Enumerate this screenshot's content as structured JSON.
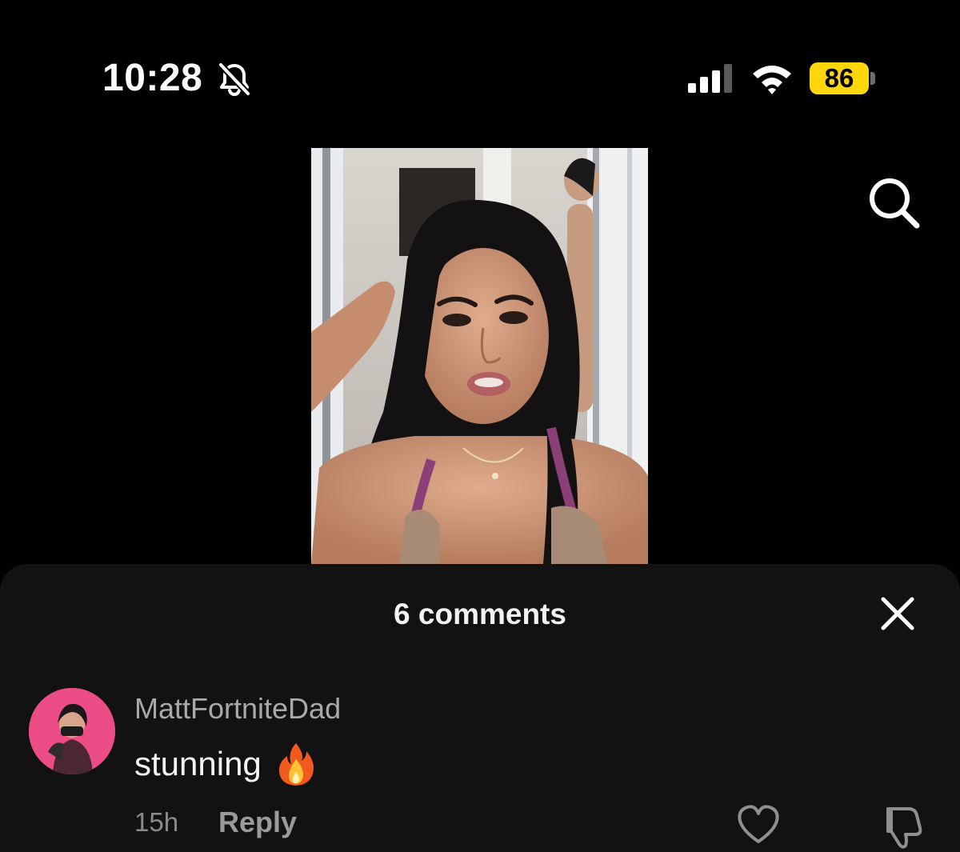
{
  "status_bar": {
    "time": "10:28",
    "battery_level": "86",
    "icons": [
      "bell-slash-icon",
      "cellular-signal-icon",
      "wifi-icon",
      "battery-icon"
    ]
  },
  "video": {
    "description_icon": "video-frame"
  },
  "top_actions": {
    "search_icon": "search-icon"
  },
  "comments_sheet": {
    "title": "6 comments",
    "close_icon": "close-icon",
    "comments": [
      {
        "username": "MattFortniteDad",
        "text": "stunning",
        "emoji": "fire-emoji",
        "age": "15h",
        "reply_label": "Reply",
        "like_icon": "heart-icon",
        "dislike_icon": "thumbs-down-icon"
      }
    ]
  },
  "colors": {
    "background": "#000000",
    "sheet": "#121212",
    "battery": "#ffd60a",
    "avatar": "#ec4d86",
    "muted_text": "#a9a9a9"
  }
}
